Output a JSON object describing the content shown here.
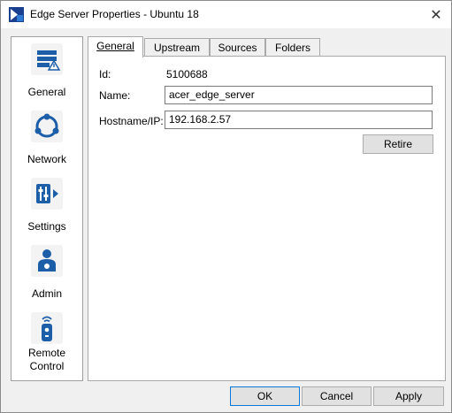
{
  "window": {
    "title": "Edge Server Properties - Ubuntu 18",
    "close_glyph": "✕"
  },
  "sidebar": {
    "items": [
      {
        "label": "General",
        "icon": "server-icon"
      },
      {
        "label": "Network",
        "icon": "network-icon"
      },
      {
        "label": "Settings",
        "icon": "settings-icon"
      },
      {
        "label": "Admin",
        "icon": "admin-icon"
      },
      {
        "label_line1": "Remote",
        "label_line2": "Control",
        "icon": "remote-control-icon"
      }
    ]
  },
  "tabs": [
    {
      "label": "General",
      "active": true
    },
    {
      "label": "Upstream",
      "active": false
    },
    {
      "label": "Sources",
      "active": false
    },
    {
      "label": "Folders",
      "active": false
    }
  ],
  "general": {
    "id_label": "Id:",
    "id_value": "5100688",
    "name_label": "Name:",
    "name_value": "acer_edge_server",
    "host_label": "Hostname/IP:",
    "host_value": "192.168.2.57",
    "retire_label": "Retire"
  },
  "footer": {
    "ok_label": "OK",
    "cancel_label": "Cancel",
    "apply_label": "Apply"
  },
  "colors": {
    "icon_blue": "#1c5ea8",
    "accent": "#0078d7"
  }
}
